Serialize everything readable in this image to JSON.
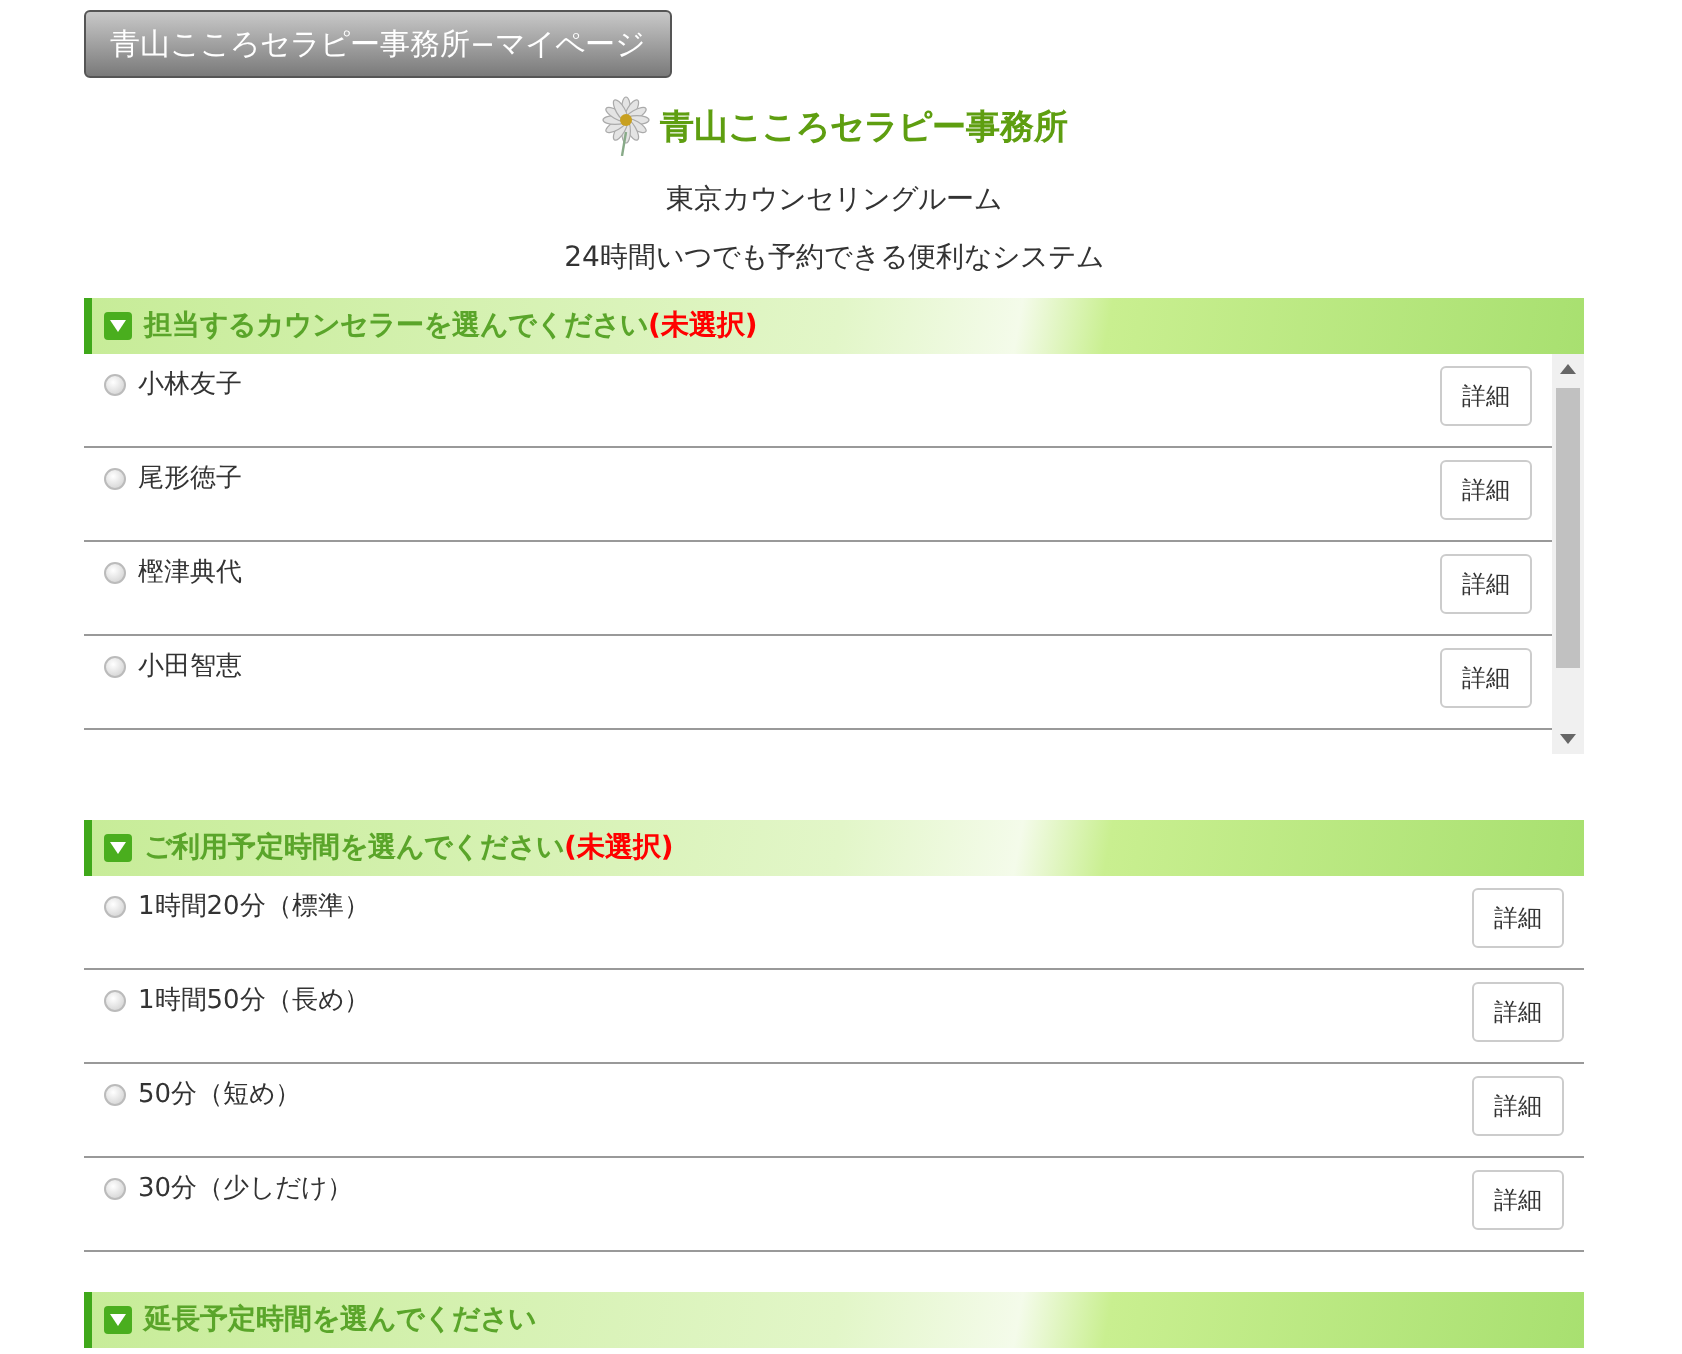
{
  "mypage_button": "青山こころセラピー事務所−マイページ",
  "logo": {
    "text": "青山こころセラピー事務所"
  },
  "subtitle": "東京カウンセリングルーム",
  "tagline": "24時間いつでも予約できる便利なシステム",
  "sections": [
    {
      "title": "担当するカウンセラーを選んでください",
      "status": "(未選択)",
      "scrollable": true,
      "options": [
        {
          "label": "小林友子",
          "selected": false,
          "button": "詳細"
        },
        {
          "label": "尾形徳子",
          "selected": false,
          "button": "詳細"
        },
        {
          "label": "樫津典代",
          "selected": false,
          "button": "詳細"
        },
        {
          "label": "小田智恵",
          "selected": false,
          "button": "詳細"
        }
      ]
    },
    {
      "title": "ご利用予定時間を選んでください",
      "status": "(未選択)",
      "scrollable": false,
      "options": [
        {
          "label": "1時間20分（標準）",
          "selected": false,
          "button": "詳細"
        },
        {
          "label": "1時間50分（長め）",
          "selected": false,
          "button": "詳細"
        },
        {
          "label": "50分（短め）",
          "selected": false,
          "button": "詳細"
        },
        {
          "label": "30分（少しだけ）",
          "selected": false,
          "button": "詳細"
        }
      ]
    },
    {
      "title": "延長予定時間を選んでください"
    }
  ]
}
